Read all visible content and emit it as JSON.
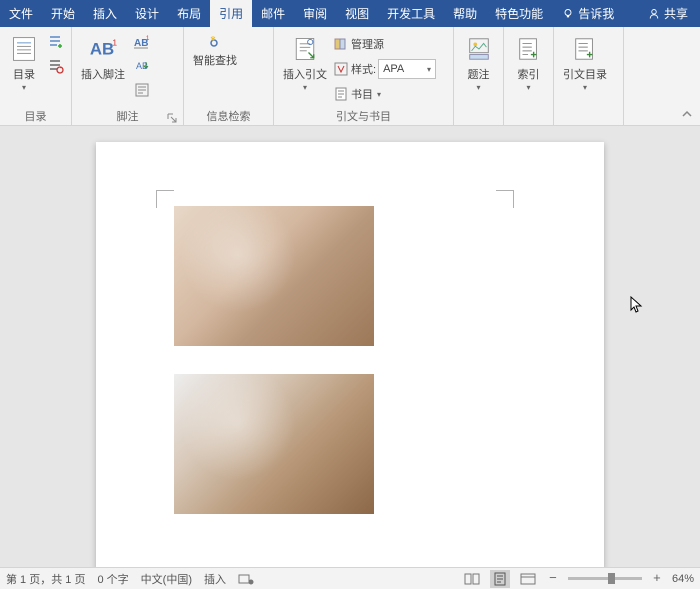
{
  "tabs": {
    "file": "文件",
    "home": "开始",
    "insert": "插入",
    "design": "设计",
    "layout": "布局",
    "references": "引用",
    "mail": "邮件",
    "review": "审阅",
    "view": "视图",
    "dev": "开发工具",
    "help": "帮助",
    "special": "特色功能",
    "tellme": "告诉我",
    "share": "共享"
  },
  "ribbon": {
    "toc": {
      "label": "目录",
      "btn": "目录"
    },
    "footnote": {
      "label": "脚注",
      "btn": "插入脚注"
    },
    "smartlookup": {
      "label": "信息检索",
      "btn": "智能查找"
    },
    "citations": {
      "label": "引文与书目",
      "insert": "插入引文",
      "manage": "管理源",
      "style_label": "样式:",
      "style_value": "APA",
      "biblio": "书目"
    },
    "caption": {
      "label": "题注",
      "btn": "题注"
    },
    "index": {
      "label": "索引",
      "btn": "索引"
    },
    "toa": {
      "label": "引文目录",
      "btn": "引文目录"
    }
  },
  "status": {
    "page": "第 1 页，共 1 页",
    "words": "0 个字",
    "lang": "中文(中国)",
    "mode": "插入",
    "zoom": "64%"
  }
}
